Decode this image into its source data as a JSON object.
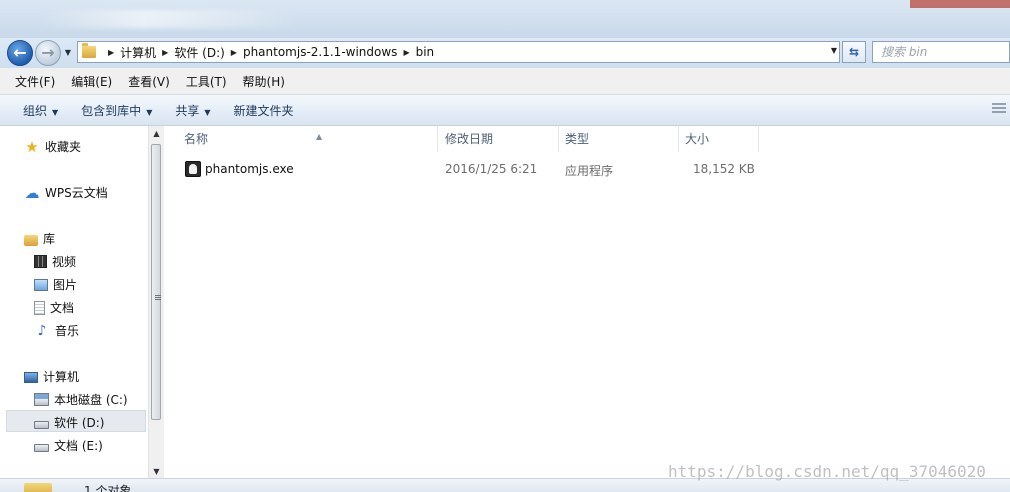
{
  "address_bar": {
    "crumbs": [
      "计算机",
      "软件 (D:)",
      "phantomjs-2.1.1-windows",
      "bin"
    ],
    "search_placeholder": "搜索 bin"
  },
  "menu": [
    "文件(F)",
    "编辑(E)",
    "查看(V)",
    "工具(T)",
    "帮助(H)"
  ],
  "toolbar": {
    "organize": "组织",
    "include_in_library": "包含到库中",
    "share": "共享",
    "new_folder": "新建文件夹"
  },
  "sidebar": {
    "favorites": "收藏夹",
    "wps_cloud": "WPS云文档",
    "libraries": "库",
    "lib_items": [
      "视频",
      "图片",
      "文档",
      "音乐"
    ],
    "computer": "计算机",
    "drives": [
      "本地磁盘 (C:)",
      "软件 (D:)",
      "文档 (E:)"
    ],
    "selected": "软件 (D:)"
  },
  "columns": {
    "name": "名称",
    "date": "修改日期",
    "type": "类型",
    "size": "大小"
  },
  "files": [
    {
      "name": "phantomjs.exe",
      "date": "2016/1/25 6:21",
      "type": "应用程序",
      "size": "18,152 KB"
    }
  ],
  "status": {
    "count_text": "1 个对象"
  },
  "watermark": "https://blog.csdn.net/qq_37046020",
  "colors": {
    "accent": "#2b62b6",
    "header_text": "#4c607a",
    "selection": "#e6eaef"
  }
}
